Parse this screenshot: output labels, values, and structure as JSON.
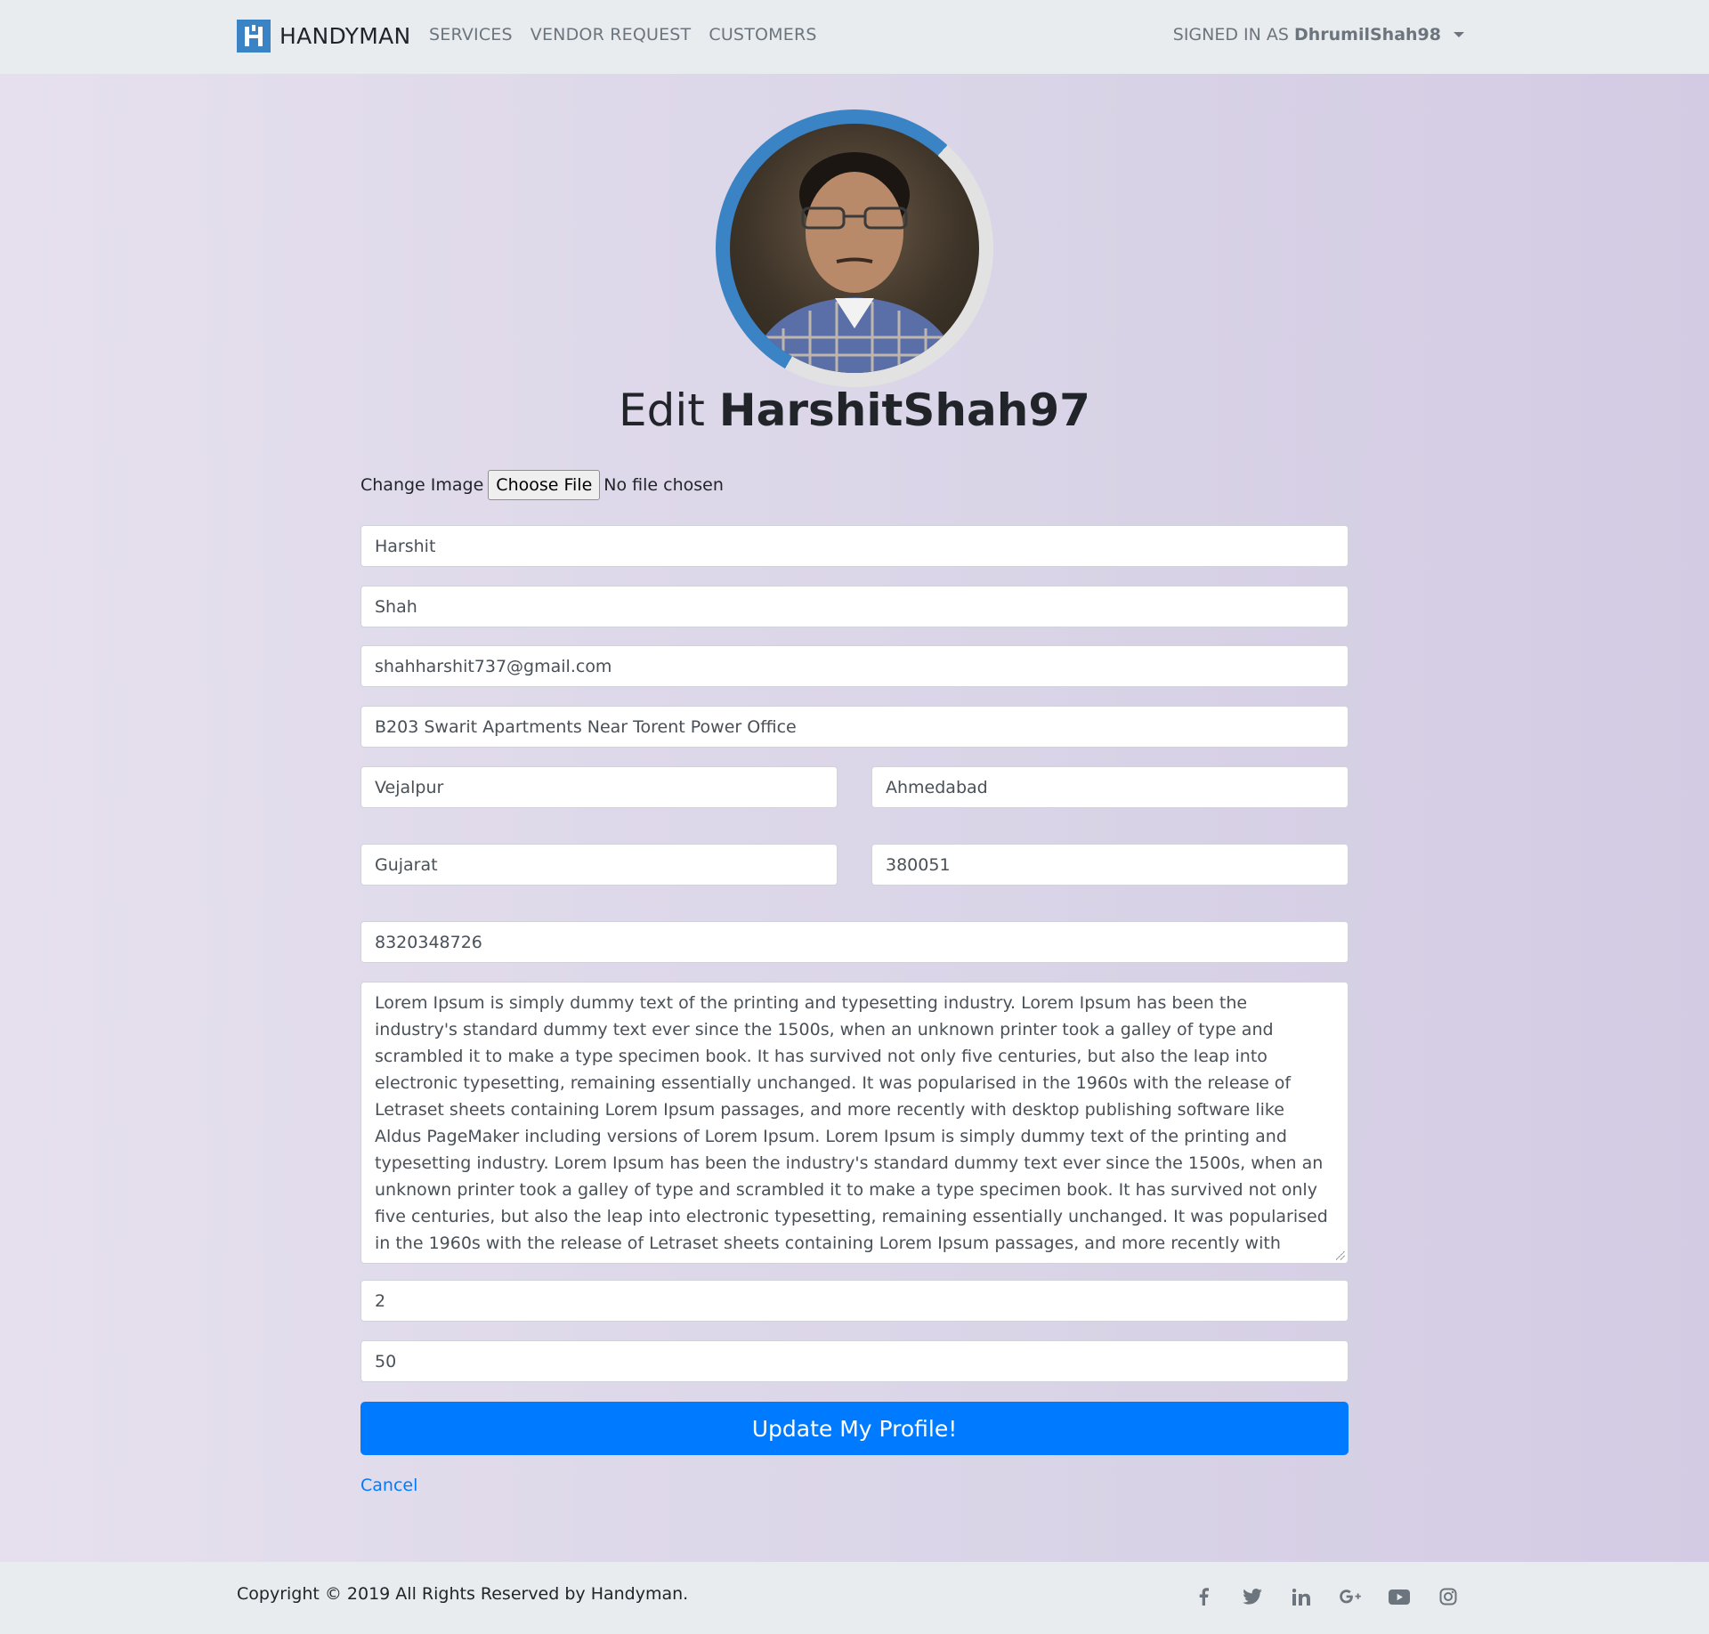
{
  "navbar": {
    "brand": "HANDYMAN",
    "links": [
      "SERVICES",
      "VENDOR REQUEST",
      "CUSTOMERS"
    ],
    "signed_in_prefix": "SIGNED IN AS",
    "username": "DhrumilShah98"
  },
  "profile": {
    "title_prefix": "Edit",
    "title_username": "HarshitShah97"
  },
  "form": {
    "change_image_label": "Change Image",
    "choose_file_label": "Choose File",
    "file_status": "No file chosen",
    "first_name": "Harshit",
    "last_name": "Shah",
    "email": "shahharshit737@gmail.com",
    "address": "B203 Swarit Apartments Near Torent Power Office",
    "area": "Vejalpur",
    "city": "Ahmedabad",
    "state": "Gujarat",
    "pincode": "380051",
    "phone": "8320348726",
    "description": "Lorem Ipsum is simply dummy text of the printing and typesetting industry. Lorem Ipsum has been the industry's standard dummy text ever since the 1500s, when an unknown printer took a galley of type and scrambled it to make a type specimen book. It has survived not only five centuries, but also the leap into electronic typesetting, remaining essentially unchanged. It was popularised in the 1960s with the release of Letraset sheets containing Lorem Ipsum passages, and more recently with desktop publishing software like Aldus PageMaker including versions of Lorem Ipsum. Lorem Ipsum is simply dummy text of the printing and typesetting industry. Lorem Ipsum has been the industry's standard dummy text ever since the 1500s, when an unknown printer took a galley of type and scrambled it to make a type specimen book. It has survived not only five centuries, but also the leap into electronic typesetting, remaining essentially unchanged. It was popularised in the 1960s with the release of Letraset sheets containing Lorem Ipsum passages, and more recently with desktop publishing software like Aldus PageMaker including versions of Lorem Ipsum.",
    "experience": "2",
    "rate": "50",
    "submit_label": "Update My Profile!",
    "cancel_label": "Cancel"
  },
  "footer": {
    "copyright": "Copyright © 2019 All Rights Reserved by Handyman.",
    "social_icons": [
      "facebook-icon",
      "twitter-icon",
      "linkedin-icon",
      "google-plus-icon",
      "youtube-icon",
      "instagram-icon"
    ]
  },
  "colors": {
    "brand": "#3a83c4",
    "primary": "#007bff",
    "navbar_bg": "#e9ecef"
  }
}
